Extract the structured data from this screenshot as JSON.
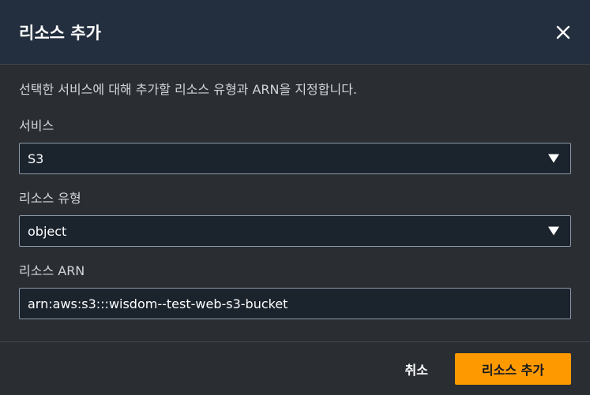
{
  "dialog": {
    "title": "리소스 추가",
    "description": "선택한 서비스에 대해 추가할 리소스 유형과 ARN을 지정합니다."
  },
  "service": {
    "label": "서비스",
    "selected": "S3"
  },
  "resource_type": {
    "label": "리소스 유형",
    "selected": "object"
  },
  "resource_arn": {
    "label": "리소스 ARN",
    "value": "arn:aws:s3:::wisdom--test-web-s3-bucket"
  },
  "footer": {
    "cancel_label": "취소",
    "add_label": "리소스 추가"
  },
  "colors": {
    "primary": "#ff9900",
    "header_bg": "#232f3e",
    "body_bg": "#2a2e33",
    "input_bg": "#1b232d"
  },
  "icons": {
    "close": "close-icon",
    "dropdown": "caret-down-icon"
  }
}
